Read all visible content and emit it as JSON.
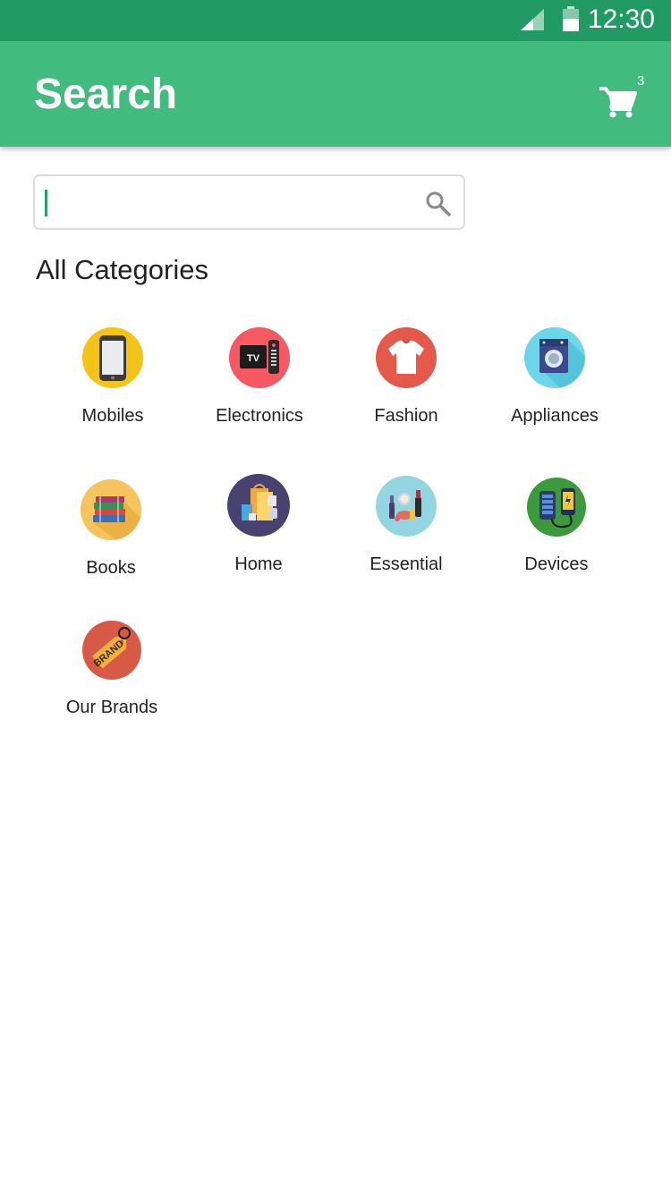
{
  "status_bar": {
    "time": "12:30"
  },
  "header": {
    "title": "Search",
    "cart_count": "3"
  },
  "search": {
    "value": "",
    "placeholder": ""
  },
  "section": {
    "title": "All Categories"
  },
  "categories": [
    {
      "label": "Mobiles",
      "icon": "mobile-phone-icon",
      "color": "#f3c318"
    },
    {
      "label": "Electronics",
      "icon": "tv-remote-icon",
      "color": "#f55a63"
    },
    {
      "label": "Fashion",
      "icon": "t-shirt-icon",
      "color": "#e4594a"
    },
    {
      "label": "Appliances",
      "icon": "washing-machine-icon",
      "color": "#6dd6ea"
    },
    {
      "label": "Books",
      "icon": "books-stack-icon",
      "color": "#f6c45c"
    },
    {
      "label": "Home",
      "icon": "shopping-bags-icon",
      "color": "#474270"
    },
    {
      "label": "Essential",
      "icon": "cosmetics-icon",
      "color": "#93d6e2"
    },
    {
      "label": "Devices",
      "icon": "power-bank-icon",
      "color": "#3a9a3c"
    },
    {
      "label": "Our Brands",
      "icon": "brand-tag-icon",
      "color": "#d75a46"
    }
  ],
  "colors": {
    "status_bar": "#229a63",
    "app_bar": "#42bb7f",
    "accent": "#2e9d6b"
  }
}
